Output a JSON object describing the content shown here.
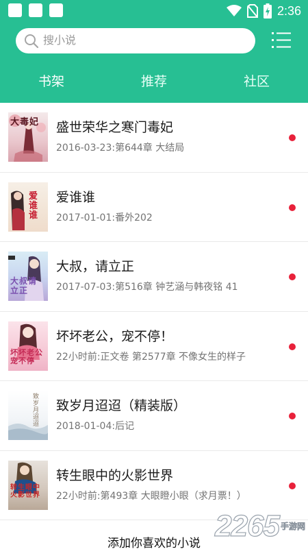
{
  "status_bar": {
    "time": "2:36",
    "icons": [
      "notification-square-icon",
      "notification-square-icon",
      "notification-square-icon",
      "wifi-icon",
      "no-sim-icon",
      "battery-charging-icon"
    ]
  },
  "search": {
    "placeholder": "搜小说",
    "icon": "search-icon"
  },
  "menu": {
    "icon": "list-menu-icon"
  },
  "tabs": [
    {
      "label": "书架",
      "active": true
    },
    {
      "label": "推荐",
      "active": false
    },
    {
      "label": "社区",
      "active": false
    }
  ],
  "books": [
    {
      "title": "盛世荣华之寒门毒妃",
      "subtitle": "2016-03-23:第644章 大结局",
      "cover_text": "大毒妃",
      "unread": true
    },
    {
      "title": "爱谁谁",
      "subtitle": "2017-01-01:番外202",
      "cover_text": "爱谁谁",
      "unread": true
    },
    {
      "title": "大叔，请立正",
      "subtitle": "2017-07-03:第516章 钟艺涵与韩夜铭 41",
      "cover_text": "大叔请立正",
      "unread": true
    },
    {
      "title": "坏坏老公，宠不停！",
      "subtitle": "22小时前:正文卷 第2577章 不像女生的样子",
      "cover_text": "坏坏老公宠不停",
      "unread": true
    },
    {
      "title": "致岁月迢迢（精装版）",
      "subtitle": "2018-01-04:后记",
      "cover_text": "致岁月迢迢",
      "unread": true
    },
    {
      "title": "转生眼中的火影世界",
      "subtitle": "22小时前:第493章 大眼瞪小眼（求月票！）",
      "cover_text": "转生眼中火影世界",
      "unread": true
    }
  ],
  "footer": {
    "add_label": "添加你喜欢的小说"
  },
  "watermark": {
    "number": "2265",
    "text": "手游网"
  },
  "colors": {
    "primary": "#27bf93",
    "unread_dot": "#e8213a"
  }
}
